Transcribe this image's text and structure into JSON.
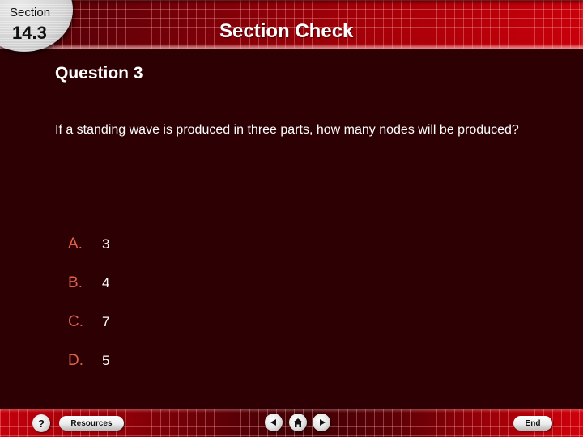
{
  "header": {
    "section_label": "Section",
    "section_number": "14.3",
    "title": "Section Check"
  },
  "question": {
    "title": "Question 3",
    "text": "If a standing wave is produced in three parts, how many nodes will be produced?"
  },
  "answers": [
    {
      "letter": "A.",
      "value": "3"
    },
    {
      "letter": "B.",
      "value": "4"
    },
    {
      "letter": "C.",
      "value": "7"
    },
    {
      "letter": "D.",
      "value": "5"
    }
  ],
  "footer": {
    "help_label": "?",
    "resources_label": "Resources",
    "end_label": "End",
    "icons": {
      "previous": "triangle-left",
      "home": "house",
      "next": "triangle-right"
    }
  },
  "colors": {
    "background": "#2d0003",
    "header_red": "#c8000a",
    "answer_letter": "#e0604a",
    "text": "#ffffff"
  }
}
